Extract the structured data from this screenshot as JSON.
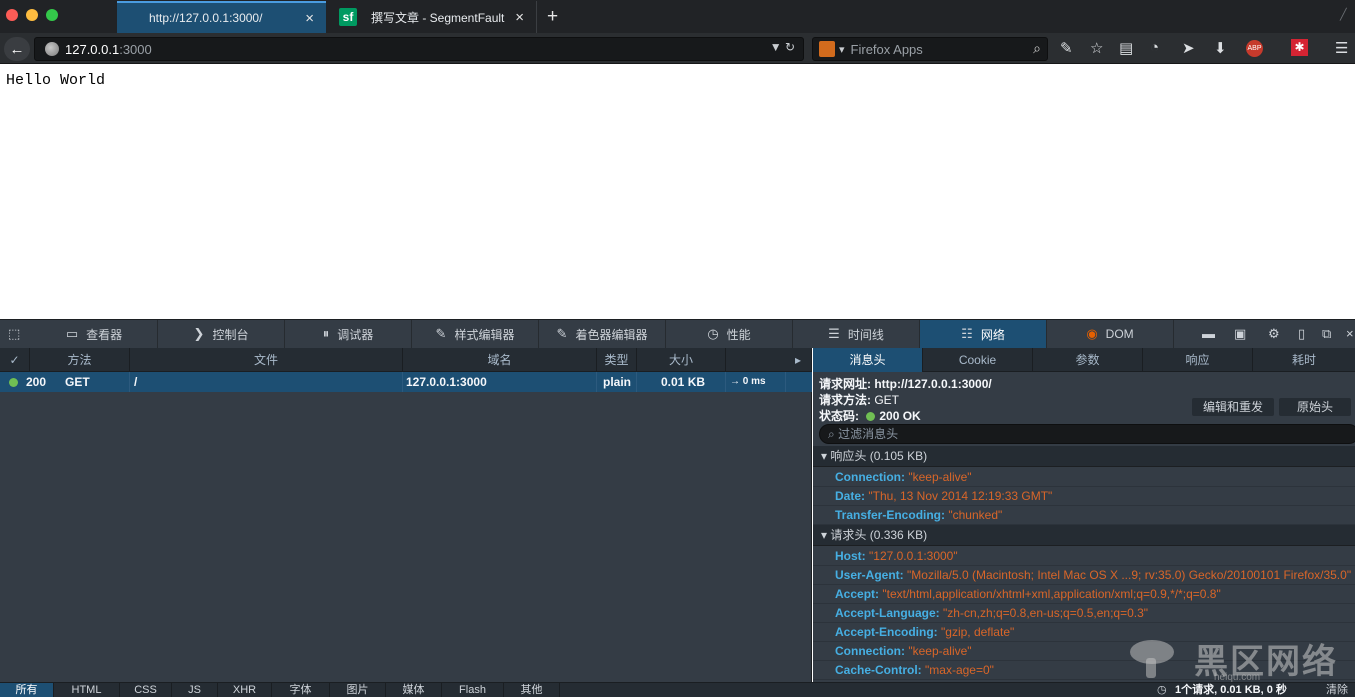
{
  "window": {
    "dot_colors": [
      "#fc5c56",
      "#fdbc40",
      "#34c84a"
    ]
  },
  "tabs": [
    {
      "label": "http://127.0.0.1:3000/",
      "close": "×"
    },
    {
      "favicon": "sf",
      "label": "撰写文章 - SegmentFault",
      "close": "×"
    }
  ],
  "newtab": "+",
  "navbar": {
    "url_host": "127.0.0.1",
    "url_port": ":3000",
    "url_controls": "▼ ↻",
    "search_placeholder": "Firefox Apps",
    "search_engine_caret": "▾",
    "icons": [
      "wrench-icon",
      "star-icon",
      "reading-list-icon",
      "history-icon",
      "send-icon",
      "download-icon",
      "adblock-icon",
      "addon-icon",
      "menu-icon"
    ]
  },
  "page": {
    "text": "Hello World"
  },
  "devtools": {
    "tools": [
      {
        "label": "查看器",
        "icon": "inspector-icon"
      },
      {
        "label": "控制台",
        "icon": "console-icon"
      },
      {
        "label": "调试器",
        "icon": "debugger-icon"
      },
      {
        "label": "样式编辑器",
        "icon": "style-editor-icon"
      },
      {
        "label": "着色器编辑器",
        "icon": "shader-editor-icon"
      },
      {
        "label": "性能",
        "icon": "performance-icon"
      },
      {
        "label": "时间线",
        "icon": "timeline-icon"
      },
      {
        "label": "网络",
        "icon": "network-icon"
      },
      {
        "label": "DOM",
        "icon": "dom-icon"
      }
    ],
    "selected_tool": "网络",
    "table": {
      "headers": [
        "✓",
        "方法",
        "文件",
        "域名",
        "类型",
        "大小",
        "▸"
      ],
      "rows": [
        {
          "status": "200",
          "method": "GET",
          "file": "/",
          "domain": "127.0.0.1:3000",
          "type": "plain",
          "size": "0.01 KB",
          "timing": "→ 0 ms"
        }
      ]
    },
    "detail_tabs": [
      "消息头",
      "Cookie",
      "参数",
      "响应",
      "耗时"
    ],
    "summary": {
      "url_label": "请求网址:",
      "url": "http://127.0.0.1:3000/",
      "method_label": "请求方法:",
      "method": "GET",
      "status_label": "状态码:",
      "status": "200 OK"
    },
    "buttons": {
      "edit_resend": "编辑和重发",
      "raw_headers": "原始头"
    },
    "filter_placeholder": "过滤消息头",
    "response_section": "响应头 (0.105 KB)",
    "response_headers": [
      {
        "k": "Connection:",
        "v": "\"keep-alive\""
      },
      {
        "k": "Date:",
        "v": "\"Thu, 13 Nov 2014 12:19:33 GMT\""
      },
      {
        "k": "Transfer-Encoding:",
        "v": "\"chunked\""
      }
    ],
    "request_section": "请求头 (0.336 KB)",
    "request_headers": [
      {
        "k": "Host:",
        "v": "\"127.0.0.1:3000\""
      },
      {
        "k": "User-Agent:",
        "v": "\"Mozilla/5.0 (Macintosh; Intel Mac OS X ...9; rv:35.0) Gecko/20100101 Firefox/35.0\""
      },
      {
        "k": "Accept:",
        "v": "\"text/html,application/xhtml+xml,application/xml;q=0.9,*/*;q=0.8\""
      },
      {
        "k": "Accept-Language:",
        "v": "\"zh-cn,zh;q=0.8,en-us;q=0.5,en;q=0.3\""
      },
      {
        "k": "Accept-Encoding:",
        "v": "\"gzip, deflate\""
      },
      {
        "k": "Connection:",
        "v": "\"keep-alive\""
      },
      {
        "k": "Cache-Control:",
        "v": "\"max-age=0\""
      }
    ],
    "filters": [
      "所有",
      "HTML",
      "CSS",
      "JS",
      "XHR",
      "字体",
      "图片",
      "媒体",
      "Flash",
      "其他"
    ],
    "footer_summary": "1个请求, 0.01 KB, 0 秒",
    "clear": "清除"
  },
  "watermark": {
    "title": "黑区网络",
    "sub": "heiqu.com"
  }
}
